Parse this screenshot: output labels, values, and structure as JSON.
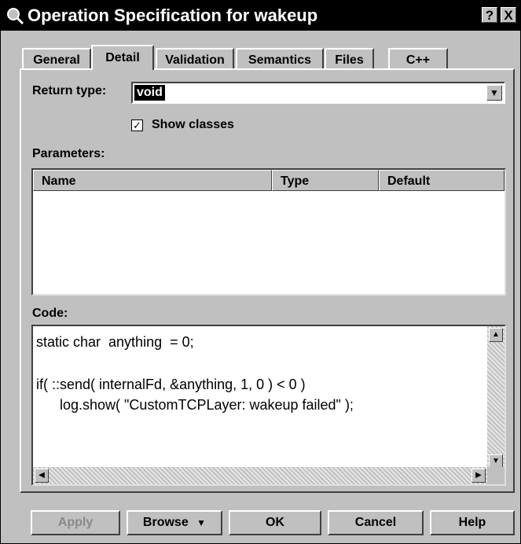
{
  "window": {
    "title": "Operation Specification for wakeup",
    "help_btn": "?",
    "close_btn": "X"
  },
  "tabs": [
    "General",
    "Detail",
    "Validation",
    "Semantics",
    "Files",
    "C++"
  ],
  "detail": {
    "return_type_label": "Return type:",
    "return_type_value": "void",
    "show_classes_label": "Show classes",
    "show_classes_checked": true,
    "parameters_label": "Parameters:",
    "parameters_columns": [
      "Name",
      "Type",
      "Default"
    ],
    "code_label": "Code:",
    "code_lines": [
      "static char  anything  = 0;",
      "",
      "if( ::send( internalFd, &anything, 1, 0 ) < 0 )",
      "      log.show( \"CustomTCPLayer: wakeup failed\" );"
    ]
  },
  "buttons": {
    "apply": "Apply",
    "browse": "Browse",
    "ok": "OK",
    "cancel": "Cancel",
    "help": "Help"
  },
  "icons": {
    "title": "magnifier-icon",
    "dropdown": "down-arrow-icon"
  }
}
